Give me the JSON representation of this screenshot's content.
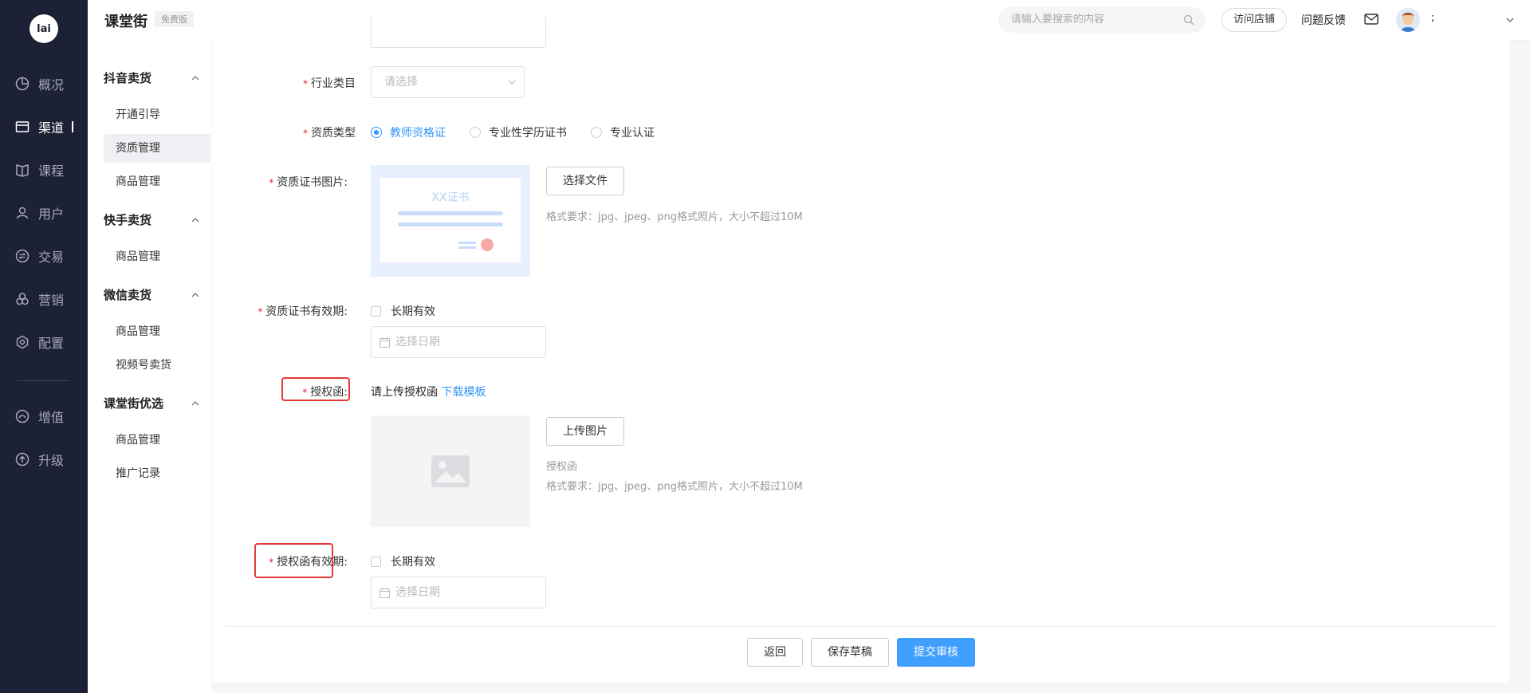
{
  "app": {
    "logo_text": "lai",
    "brand": "课堂街",
    "edition": "免费版"
  },
  "nav": {
    "items": [
      {
        "label": "概况",
        "icon": "pie-chart-icon"
      },
      {
        "label": "渠道",
        "icon": "store-icon"
      },
      {
        "label": "课程",
        "icon": "book-icon"
      },
      {
        "label": "用户",
        "icon": "user-icon"
      },
      {
        "label": "交易",
        "icon": "exchange-icon"
      },
      {
        "label": "营销",
        "icon": "marketing-icon"
      },
      {
        "label": "配置",
        "icon": "gear-icon"
      },
      {
        "label": "增值",
        "icon": "value-added-icon"
      },
      {
        "label": "升级",
        "icon": "upgrade-icon"
      }
    ],
    "active": "渠道"
  },
  "submenu": {
    "groups": [
      {
        "title": "抖音卖货",
        "items": [
          "开通引导",
          "资质管理",
          "商品管理"
        ]
      },
      {
        "title": "快手卖货",
        "items": [
          "商品管理"
        ]
      },
      {
        "title": "微信卖货",
        "items": [
          "商品管理",
          "视频号卖货"
        ]
      },
      {
        "title": "课堂街优选",
        "items": [
          "商品管理",
          "推广记录"
        ]
      }
    ],
    "active_item": "资质管理"
  },
  "topbar": {
    "search_placeholder": "请输入要搜索的内容",
    "visit_store": "访问店铺",
    "feedback": "问题反馈",
    "username": ";"
  },
  "form": {
    "industry": {
      "label": "行业类目",
      "placeholder": "请选择"
    },
    "qualification_type": {
      "label": "资质类型",
      "options": [
        "教师资格证",
        "专业性学历证书",
        "专业认证"
      ],
      "selected": "教师资格证"
    },
    "cert_image": {
      "label": "资质证书图片:",
      "sample_text": "XX证书",
      "button": "选择文件",
      "hint": "格式要求：jpg、jpeg、png格式照片，大小不超过10M"
    },
    "cert_validity": {
      "label": "资质证书有效期:",
      "checkbox": "长期有效",
      "date_placeholder": "选择日期"
    },
    "authorization": {
      "label": "授权函:",
      "prompt": "请上传授权函",
      "download": "下载模板",
      "button": "上传图片",
      "caption": "授权函",
      "hint": "格式要求：jpg、jpeg、png格式照片，大小不超过10M"
    },
    "authorization_validity": {
      "label": "授权函有效期:",
      "checkbox": "长期有效",
      "date_placeholder": "选择日期"
    }
  },
  "actions": {
    "back": "返回",
    "save_draft": "保存草稿",
    "submit": "提交审核"
  },
  "colors": {
    "nav_bg": "#1c2135",
    "primary": "#409eff",
    "required": "#f5222d",
    "highlight": "#e53935"
  }
}
